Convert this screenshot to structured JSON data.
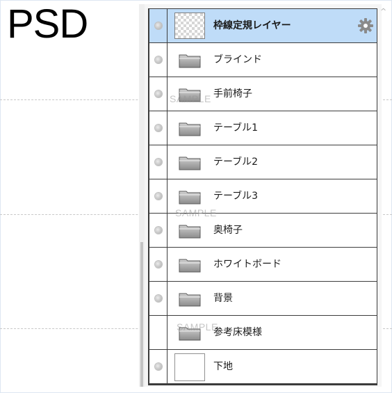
{
  "title": "PSD",
  "watermark_text": "SAMPLE",
  "layers": [
    {
      "name": "枠線定規レイヤー",
      "thumb": "checker",
      "selected": true,
      "bold": true,
      "settings_icon": "gear-icon"
    },
    {
      "name": "ブラインド",
      "thumb": "folder-icon"
    },
    {
      "name": "手前椅子",
      "thumb": "folder-icon"
    },
    {
      "name": "テーブル1",
      "thumb": "folder-icon"
    },
    {
      "name": "テーブル2",
      "thumb": "folder-icon"
    },
    {
      "name": "テーブル3",
      "thumb": "folder-icon"
    },
    {
      "name": "奥椅子",
      "thumb": "folder-icon"
    },
    {
      "name": "ホワイトボード",
      "thumb": "folder-icon"
    },
    {
      "name": "背景",
      "thumb": "folder-icon"
    },
    {
      "name": "参考床模様",
      "thumb": "folder-icon",
      "visible_toggle": false
    },
    {
      "name": "下地",
      "thumb": "white"
    }
  ],
  "colors": {
    "selected_row": "#bfdcf8",
    "row_border": "#3c3c3c",
    "panel_background": "#f5f5f5"
  }
}
